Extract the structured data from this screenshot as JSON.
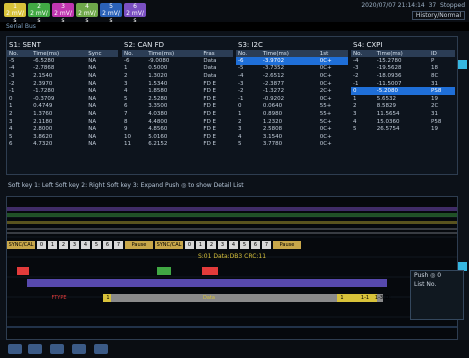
{
  "header": {
    "channels": [
      {
        "label": "1",
        "sub": "2 mV/ s",
        "color": "#d8c23a"
      },
      {
        "label": "2",
        "sub": "2 mV/ s",
        "color": "#41a844"
      },
      {
        "label": "3",
        "sub": "2 mV/ s",
        "color": "#c036b0"
      },
      {
        "label": "4",
        "sub": "2 mV/ s",
        "color": "#6fa84a"
      },
      {
        "label": "5",
        "sub": "2 mV/ s",
        "color": "#2b62b8"
      },
      {
        "label": "6",
        "sub": "2 mV/ s",
        "color": "#7a4fc2"
      }
    ],
    "datetime": "2020/07/07 21:14:14",
    "acq": "37",
    "stopped": "Stopped",
    "history_label": "History/Normal"
  },
  "status_bar": "Serial Bus",
  "panels": [
    {
      "title": "S1: SENT",
      "columns": [
        "No.",
        "Time(ms)",
        "Sync"
      ],
      "rows": [
        [
          "-5",
          "-6.5280",
          "NA"
        ],
        [
          "-4",
          "-2.7868",
          "NA"
        ],
        [
          "-3",
          "2.1540",
          "NA"
        ],
        [
          "-2",
          "2.3970",
          "NA"
        ],
        [
          "-1",
          "-1.7280",
          "NA"
        ],
        [
          "0",
          "-0.3709",
          "NA"
        ],
        [
          "1",
          "0.4749",
          "NA"
        ],
        [
          "2",
          "1.3760",
          "NA"
        ],
        [
          "3",
          "2.1180",
          "NA"
        ],
        [
          "4",
          "2.8000",
          "NA"
        ],
        [
          "5",
          "3.8620",
          "NA"
        ],
        [
          "6",
          "4.7320",
          "NA"
        ]
      ]
    },
    {
      "title": "S2: CAN FD",
      "columns": [
        "No.",
        "Time(ms)",
        "Fras"
      ],
      "rows": [
        [
          "-6",
          "-9.0080",
          "Data"
        ],
        [
          "1",
          "0.5000",
          "Data"
        ],
        [
          "2",
          "1.3020",
          "Data"
        ],
        [
          "3",
          "1.5340",
          "FD E"
        ],
        [
          "4",
          "1.8580",
          "FD E"
        ],
        [
          "5",
          "2.5280",
          "FD E"
        ],
        [
          "6",
          "3.3500",
          "FD E"
        ],
        [
          "7",
          "4.0380",
          "FD E"
        ],
        [
          "8",
          "4.4800",
          "FD E"
        ],
        [
          "9",
          "4.8560",
          "FD E"
        ],
        [
          "10",
          "5.0160",
          "FD E"
        ],
        [
          "11",
          "6.2152",
          "FD E"
        ]
      ]
    },
    {
      "title": "S3: I2C",
      "columns": [
        "No.",
        "Time(ms)",
        "1st"
      ],
      "rows": [
        [
          "-6",
          "-3.9702",
          "0C+"
        ],
        [
          "-5",
          "-3.7352",
          "0C+"
        ],
        [
          "-4",
          "-2.6512",
          "0C+"
        ],
        [
          "-3",
          "-2.3877",
          "0C+"
        ],
        [
          "-2",
          "-1.3272",
          "2C+"
        ],
        [
          "-1",
          "-0.9202",
          "0C+"
        ],
        [
          "0",
          "0.0640",
          "55+"
        ],
        [
          "1",
          "0.8980",
          "55+"
        ],
        [
          "2",
          "1.2320",
          "5C+"
        ],
        [
          "3",
          "2.5808",
          "0C+"
        ],
        [
          "4",
          "3.1540",
          "0C+"
        ],
        [
          "5",
          "3.7780",
          "0C+"
        ]
      ]
    },
    {
      "title": "S4: CXPI",
      "columns": [
        "No.",
        "Time(ms)",
        "ID"
      ],
      "rows": [
        [
          "-4",
          "-15.2780",
          "P"
        ],
        [
          "-3",
          "-19.5628",
          "18"
        ],
        [
          "-2",
          "-18.0936",
          "8C"
        ],
        [
          "-1",
          "-11.5007",
          "31"
        ],
        [
          "0",
          "-5.2080",
          "PS8"
        ],
        [
          "1",
          "5.6532",
          "19"
        ],
        [
          "2",
          "8.5829",
          "2C"
        ],
        [
          "3",
          "11.5654",
          "31"
        ],
        [
          "4",
          "15.0360",
          "P58"
        ],
        [
          "5",
          "26.5754",
          "19"
        ]
      ]
    }
  ],
  "softkey_line": "Soft key 1: Left   Soft key 2: Right   Soft key 3: Expand   Push ◎ to show Detail List",
  "decode": {
    "row1": [
      "SYNC/CAL",
      "0",
      "1",
      "2",
      "3",
      "4",
      "5",
      "6",
      "7",
      "Pause",
      "SYNC/CAL",
      "0",
      "1",
      "2",
      "3",
      "4",
      "5",
      "6",
      "7",
      "Pause"
    ],
    "row2": "S:01 Data:DB3 CRC:11",
    "row4": [
      "FTYPE",
      "1",
      "Data",
      "1",
      "1-1",
      "1-3",
      "D:"
    ]
  },
  "side_panel": {
    "line1": "Push ◎ 0",
    "line2": "List No."
  },
  "colors": {
    "accent": "#36b6e0",
    "selected_row": "#1f6fd8"
  }
}
